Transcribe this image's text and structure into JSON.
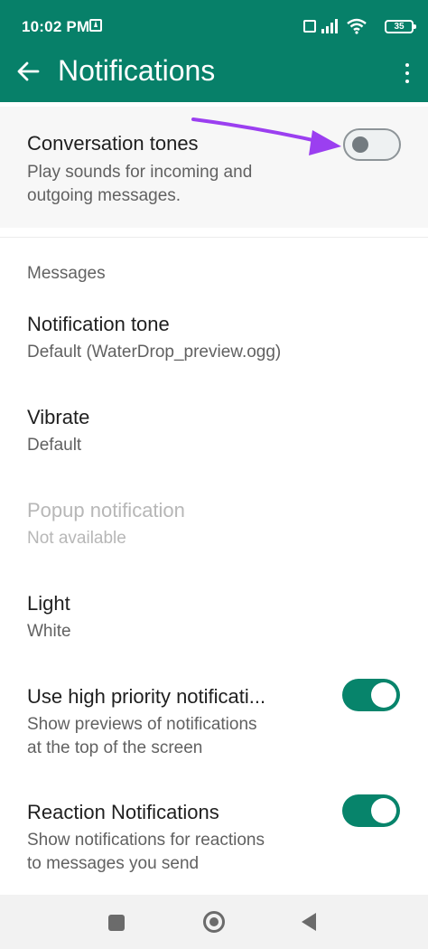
{
  "status_bar": {
    "time": "10:02 PM",
    "battery": "35"
  },
  "app_bar": {
    "title": "Notifications"
  },
  "conversation_tones": {
    "title": "Conversation tones",
    "subtitle_line1": "Play sounds for incoming and",
    "subtitle_line2": "outgoing messages.",
    "enabled": false
  },
  "messages_section": {
    "header": "Messages",
    "notification_tone": {
      "title": "Notification tone",
      "value": "Default (WaterDrop_preview.ogg)"
    },
    "vibrate": {
      "title": "Vibrate",
      "value": "Default"
    },
    "popup_notification": {
      "title": "Popup notification",
      "value": "Not available"
    },
    "light": {
      "title": "Light",
      "value": "White"
    },
    "high_priority": {
      "title": "Use high priority notificati...",
      "subtitle_line1": "Show previews of notifications",
      "subtitle_line2": "at the top of the screen",
      "enabled": true
    },
    "reaction_notifications": {
      "title": "Reaction Notifications",
      "subtitle_line1": "Show notifications for reactions",
      "subtitle_line2": "to messages you send",
      "enabled": true
    }
  },
  "colors": {
    "app_bar": "#078069",
    "toggle_on": "#07846b",
    "annotation_arrow": "#9b3ff0"
  },
  "icons": [
    "back-arrow-icon",
    "more-options-icon",
    "upload-icon",
    "volte-icon",
    "signal-icon",
    "wifi-icon",
    "battery-icon",
    "nav-recents-icon",
    "nav-home-icon",
    "nav-back-icon"
  ]
}
